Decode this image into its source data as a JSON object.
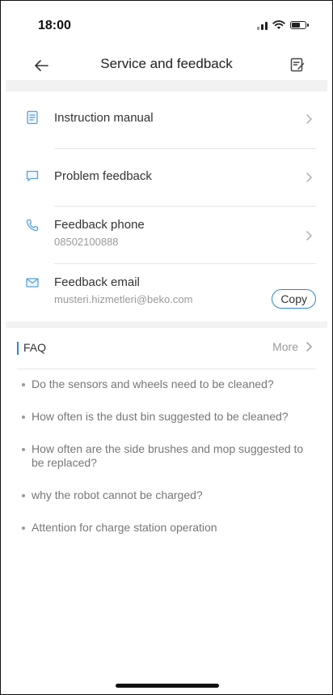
{
  "status": {
    "time": "18:00"
  },
  "nav": {
    "title": "Service and feedback"
  },
  "items": [
    {
      "label": "Instruction manual"
    },
    {
      "label": "Problem feedback"
    },
    {
      "label": "Feedback phone",
      "value": "08502100888"
    },
    {
      "label": "Feedback email",
      "value": "musteri.hizmetleri@beko.com",
      "button": "Copy"
    }
  ],
  "faq": {
    "title": "FAQ",
    "more": "More",
    "items": [
      "Do the sensors and wheels need to be cleaned?",
      "How often is the dust bin suggested to be cleaned?",
      "How often are the side brushes and mop suggested to be replaced?",
      "why the robot cannot be charged?",
      "Attention for charge station operation"
    ]
  },
  "colors": {
    "accent": "#2f86c9",
    "text": "#333333",
    "muted": "#999999"
  }
}
